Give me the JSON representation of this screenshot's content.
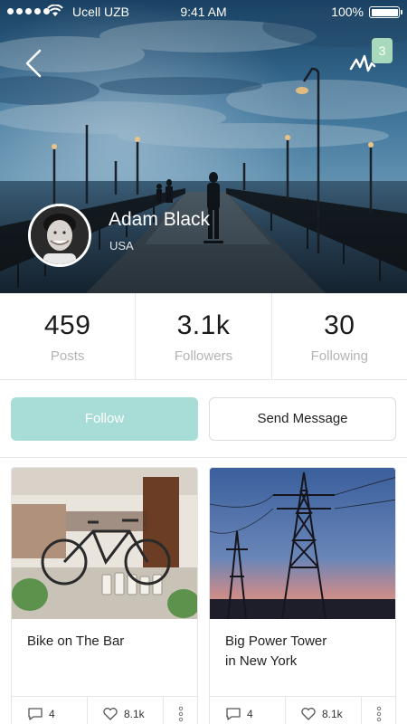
{
  "status_bar": {
    "carrier": "Ucell UZB",
    "time": "9:41 AM",
    "battery": "100%"
  },
  "header": {
    "back_icon": "chevron-left-icon",
    "activity_icon": "activity-pulse-icon",
    "notification_count": "3"
  },
  "profile": {
    "name": "Adam Black",
    "location": "USA"
  },
  "stats": [
    {
      "value": "459",
      "label": "Posts"
    },
    {
      "value": "3.1k",
      "label": "Followers"
    },
    {
      "value": "30",
      "label": "Following"
    }
  ],
  "actions": {
    "follow_label": "Follow",
    "message_label": "Send Message"
  },
  "posts": [
    {
      "title": "Bike on The Bar",
      "comments": "4",
      "likes": "8.1k"
    },
    {
      "title": "Big Power Tower\nin New York",
      "comments": "4",
      "likes": "8.1k"
    }
  ],
  "colors": {
    "accent": "#a7ddd6",
    "badge": "#a8d9bd",
    "muted_text": "#b3b3b3"
  }
}
